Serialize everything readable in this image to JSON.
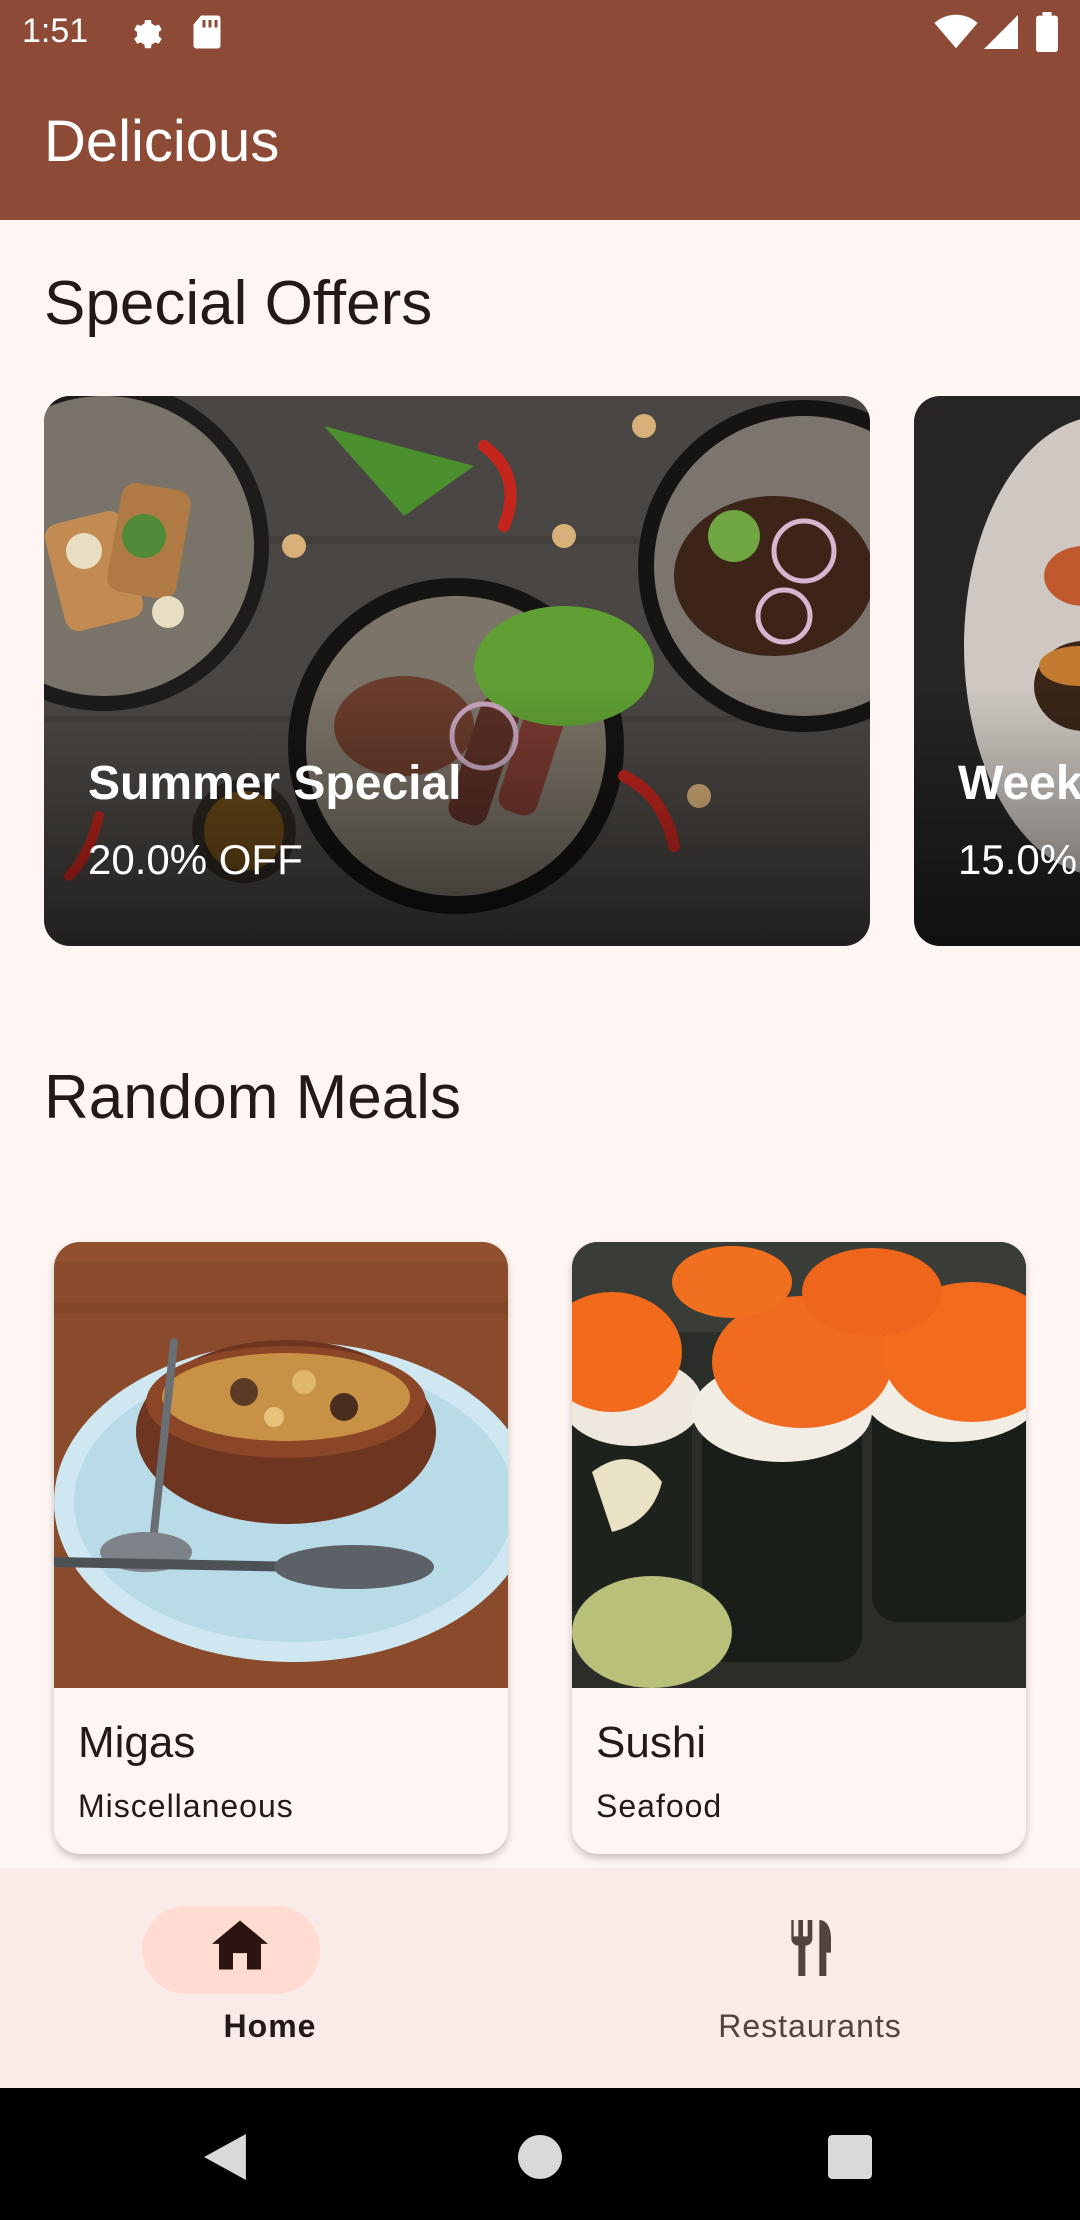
{
  "status_bar": {
    "time": "1:51",
    "icons": [
      "gear-icon",
      "sd-card-icon",
      "wifi-icon",
      "signal-icon",
      "battery-icon"
    ]
  },
  "app_bar": {
    "title": "Delicious"
  },
  "special_offers": {
    "title": "Special Offers",
    "cards": [
      {
        "title": "Summer Special",
        "discount": "20.0% OFF"
      },
      {
        "title": "Week",
        "discount": "15.0%"
      }
    ]
  },
  "random_meals": {
    "title": "Random Meals",
    "meals": [
      {
        "name": "Migas",
        "category": "Miscellaneous"
      },
      {
        "name": "Sushi",
        "category": "Seafood"
      }
    ]
  },
  "bottom_nav": {
    "items": [
      {
        "label": "Home",
        "icon": "home-icon",
        "selected": true
      },
      {
        "label": "Restaurants",
        "icon": "fork-knife-icon",
        "selected": false
      }
    ]
  },
  "colors": {
    "primary": "#8d4b37",
    "background": "#fff6f4",
    "nav_background": "#f9ebe7",
    "selected_pill": "#ffdbd1"
  }
}
